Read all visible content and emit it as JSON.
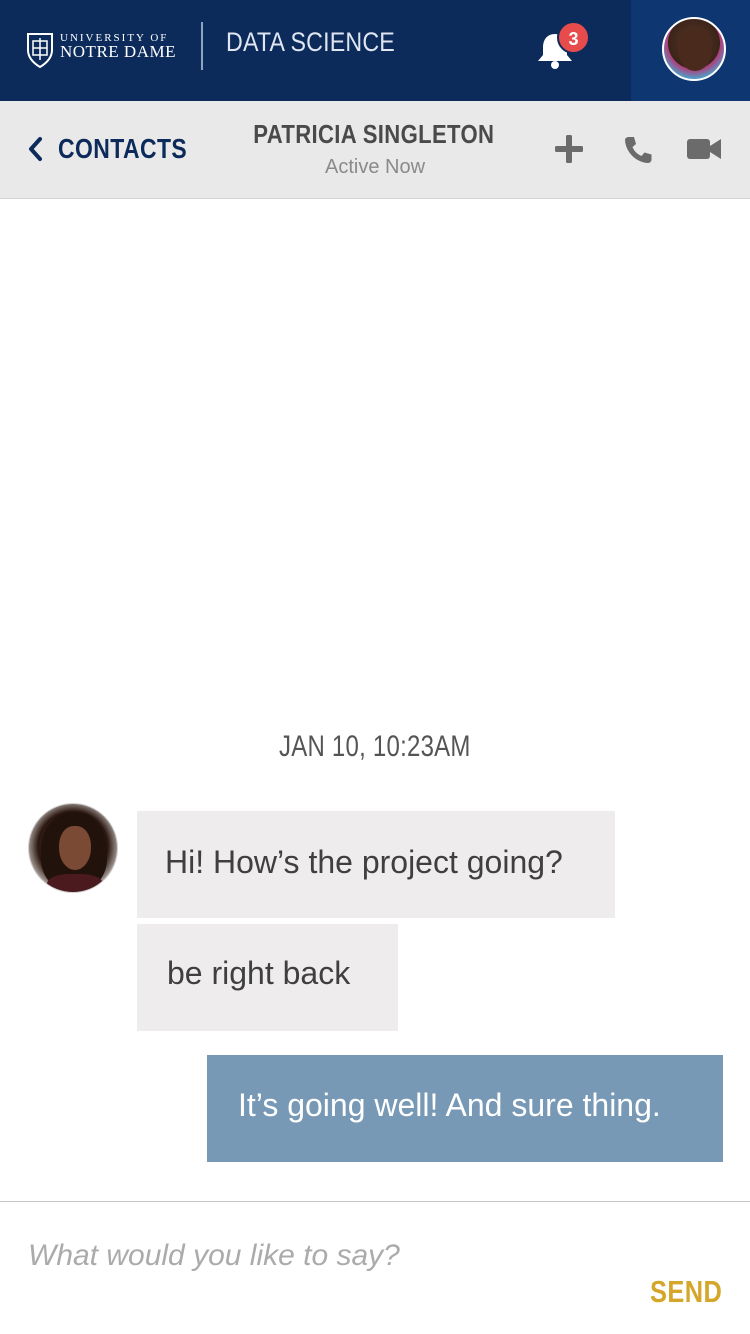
{
  "header": {
    "logo_line1": "UNIVERSITY OF",
    "logo_line2": "NOTRE DAME",
    "app_title": "DATA SCIENCE",
    "notification_count": "3",
    "colors": {
      "background": "#0c2b5b",
      "avatar_panel": "#0e3671",
      "badge": "#e84b4b"
    }
  },
  "conversation": {
    "back_label": "CONTACTS",
    "contact_name": "PATRICIA SINGLETON",
    "contact_status": "Active Now",
    "actions": [
      "plus-icon",
      "phone-icon",
      "video-icon"
    ]
  },
  "messages": {
    "timestamp": "JAN 10, 10:23AM",
    "items": [
      {
        "direction": "incoming",
        "text": "Hi! How’s the project going?"
      },
      {
        "direction": "incoming",
        "text": "be right back"
      },
      {
        "direction": "outgoing",
        "text": "It’s going well! And sure thing."
      }
    ],
    "colors": {
      "incoming_bubble": "#eeeced",
      "outgoing_bubble": "#7799b6"
    }
  },
  "composer": {
    "placeholder": "What would you like to say?",
    "value": "",
    "send_label": "SEND",
    "send_color": "#d4a62a"
  }
}
